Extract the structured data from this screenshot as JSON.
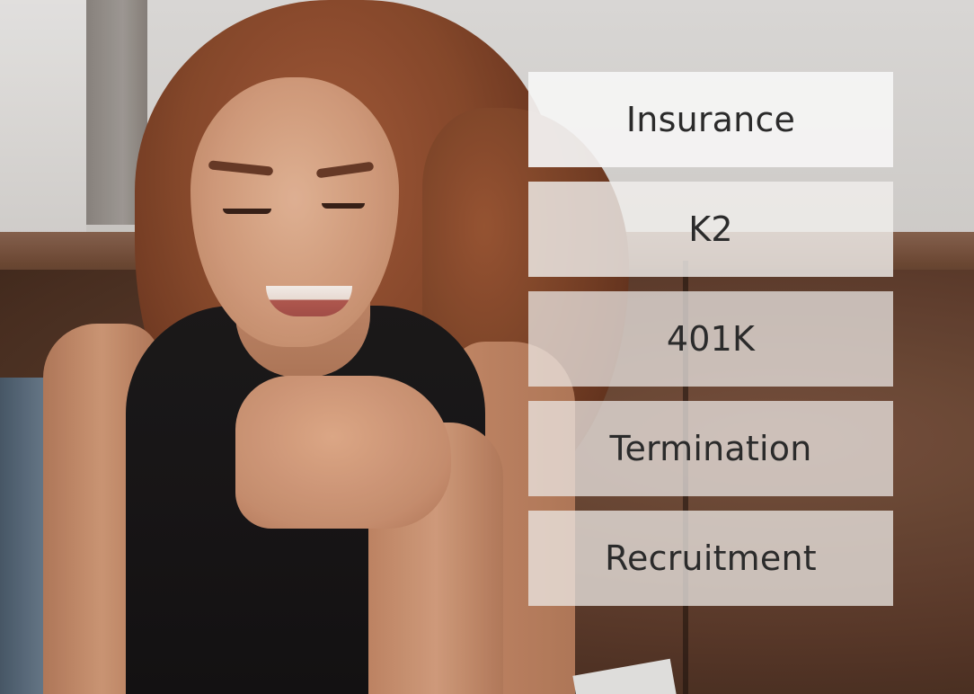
{
  "background": {
    "icon": "woman-smiling-photo"
  },
  "menu": {
    "items": [
      {
        "label": "Insurance"
      },
      {
        "label": "K2"
      },
      {
        "label": "401K"
      },
      {
        "label": "Termination"
      },
      {
        "label": "Recruitment"
      }
    ]
  },
  "colors": {
    "menu_text": "#2b2b2b",
    "menu_background": "#f2f2f2"
  }
}
